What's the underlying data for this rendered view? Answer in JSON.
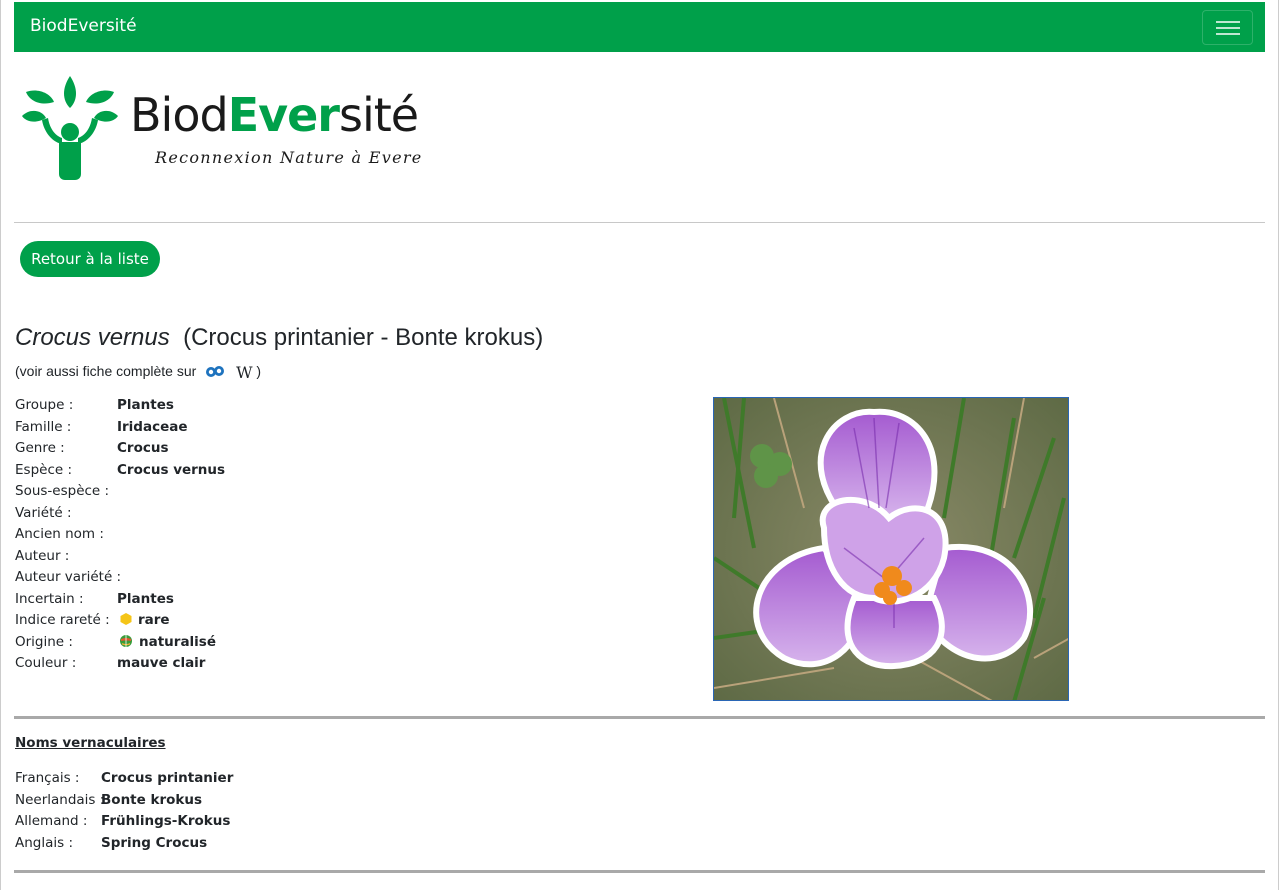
{
  "navbar": {
    "brand": "BiodEversité",
    "menu_icon": "hamburger-menu-icon"
  },
  "logo": {
    "title_pre": "Biod",
    "title_mid": "Ever",
    "title_post": "sité",
    "subtitle": "Reconnexion Nature à Evere",
    "colors": {
      "green": "#00a04a"
    }
  },
  "back_button": {
    "label": "Retour à la liste"
  },
  "species": {
    "latin_name": "Crocus vernus",
    "common_names": "(Crocus printanier - Bonte krokus)",
    "see_also_prefix": "(voir aussi fiche complète sur",
    "see_also_suffix": ")",
    "icons": [
      "observation-site-icon",
      "wikipedia-icon"
    ]
  },
  "properties": [
    {
      "label": "Groupe :",
      "value": "Plantes"
    },
    {
      "label": "Famille :",
      "value": "Iridaceae"
    },
    {
      "label": "Genre :",
      "value": "Crocus"
    },
    {
      "label": "Espèce :",
      "value": "Crocus vernus"
    },
    {
      "label": "Sous-espèce :",
      "value": ""
    },
    {
      "label": "Variété :",
      "value": ""
    },
    {
      "label": "Ancien nom :",
      "value": ""
    },
    {
      "label": "Auteur :",
      "value": ""
    },
    {
      "label": "Auteur variété :",
      "value": ""
    },
    {
      "label": "Incertain :",
      "value": "Plantes"
    },
    {
      "label": "Indice rareté :",
      "value": "rare",
      "icon": "rarity-dot-icon",
      "icon_color": "#f5c518"
    },
    {
      "label": "Origine :",
      "value": "naturalisé",
      "icon": "globe-icon"
    },
    {
      "label": "Couleur :",
      "value": "mauve clair"
    }
  ],
  "photo": {
    "subject": "purple-white crocus flower photo"
  },
  "vernacular": {
    "title": "Noms vernaculaires",
    "rows": [
      {
        "label": "Français :",
        "value": "Crocus printanier"
      },
      {
        "label": "Neerlandais :",
        "value": "Bonte krokus"
      },
      {
        "label": "Allemand :",
        "value": "Frühlings-Krokus"
      },
      {
        "label": "Anglais :",
        "value": "Spring Crocus"
      }
    ]
  }
}
